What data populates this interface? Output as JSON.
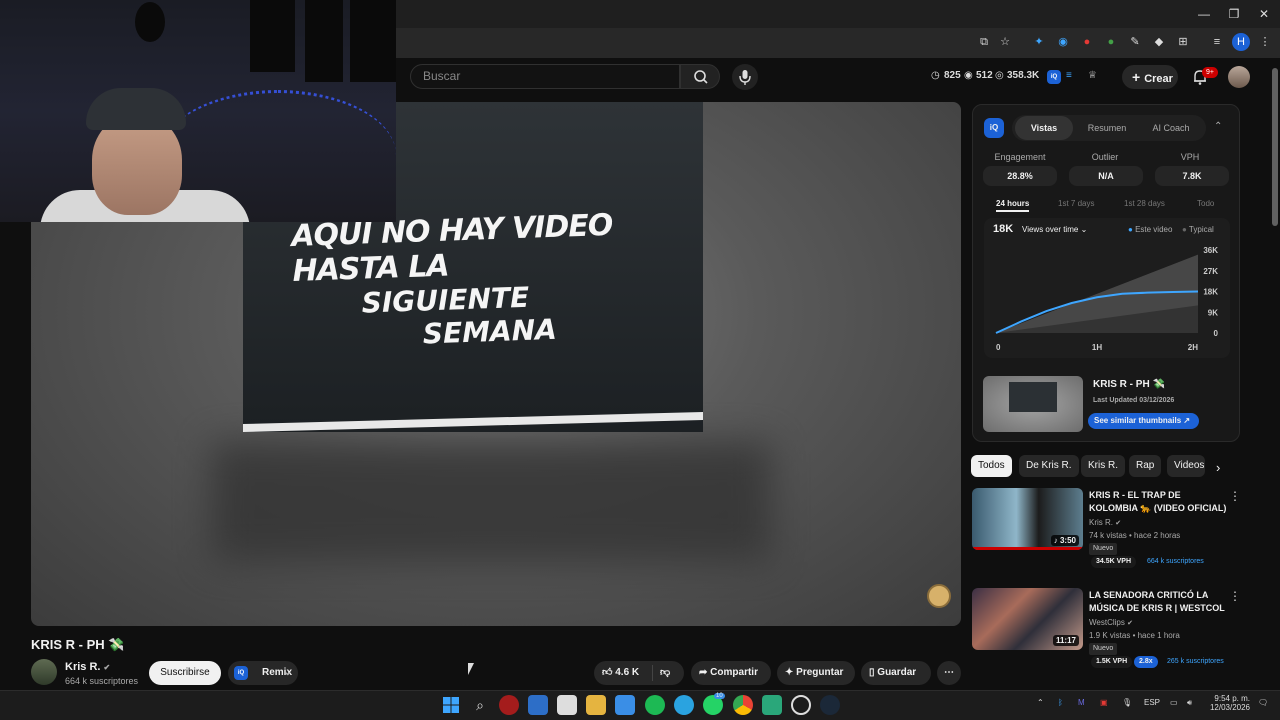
{
  "browser": {
    "controls": {
      "minimize": "—",
      "restore": "❐",
      "close": "✕"
    }
  },
  "youtube": {
    "search_placeholder": "Buscar",
    "stats": {
      "a": "825",
      "b": "512",
      "c": "358.3K"
    },
    "create_label": "Crear",
    "notif_badge": "9+"
  },
  "video": {
    "overlay_text": {
      "line1": "AQUI NO HAY VIDEO HASTA LA",
      "line2": "SIGUIENTE",
      "line3": "SEMANA"
    },
    "title": "KRIS R - PH 💸",
    "channel": {
      "name": "Kris R.",
      "subscribers": "664 k suscriptores"
    },
    "subscribe_label": "Suscribirse",
    "remix_label": "Remix",
    "likes": "4.6 K",
    "share_label": "Compartir",
    "ask_label": "Preguntar",
    "save_label": "Guardar"
  },
  "analytics": {
    "logo": "iQ",
    "tabs": [
      "Vistas",
      "Resumen",
      "AI Coach"
    ],
    "metrics": [
      {
        "label": "Engagement",
        "value": "28.8%"
      },
      {
        "label": "Outlier",
        "value": "N/A"
      },
      {
        "label": "VPH",
        "value": "7.8K"
      }
    ],
    "timeframes": [
      "24 hours",
      "1st 7 days",
      "1st 28 days",
      "Todo"
    ],
    "chart_current": "18K",
    "chart_dropdown": "Views over time",
    "legend": {
      "this": "Este video",
      "typical": "Typical"
    }
  },
  "chart_data": {
    "type": "line",
    "title": "",
    "xlabel": "",
    "ylabel": "",
    "x_ticks": [
      "0",
      "1H",
      "2H"
    ],
    "y_ticks": [
      "36K",
      "27K",
      "18K",
      "9K",
      "0"
    ],
    "ylim": [
      0,
      36000
    ],
    "series": [
      {
        "name": "Este video",
        "x": [
          0,
          0.25,
          0.5,
          0.75,
          1.0,
          1.25,
          1.5,
          1.75,
          2.0
        ],
        "values": [
          0,
          5000,
          9500,
          13000,
          15500,
          17000,
          17500,
          17800,
          18000
        ]
      },
      {
        "name": "Typical",
        "x": [
          0,
          2.0
        ],
        "values": [
          0,
          34000
        ]
      }
    ],
    "colors": {
      "this": "#3ea6ff",
      "typical": "#555555"
    }
  },
  "thumb_card": {
    "title": "KRIS R - PH 💸",
    "updated": "Last Updated 03/12/2026",
    "button": "See similar thumbnails ↗"
  },
  "chips": [
    "Todos",
    "De Kris R.",
    "Kris R.",
    "Rap",
    "Videos"
  ],
  "recommendations": [
    {
      "title": "KRIS R - EL TRAP DE KOLOMBIA 🐆 (VIDEO OFICIAL)",
      "channel": "Kris R.",
      "meta": "74 k vistas • hace 2 horas",
      "badge": "Nuevo",
      "duration": "3:50",
      "vph": "34.5K VPH",
      "subs": "664 k suscriptores"
    },
    {
      "title": "LA SENADORA CRITICÓ LA MÚSICA DE KRIS R | WESTCOL",
      "channel": "WestClips",
      "meta": "1.9 K vistas • hace 1 hora",
      "badge": "Nuevo",
      "duration": "11:17",
      "vph": "1.5K VPH",
      "mult": "2.8x",
      "subs": "265 k suscriptores"
    }
  ],
  "taskbar": {
    "lang": "ESP",
    "time": "9:54 p. m.",
    "date": "12/03/2026",
    "whatsapp_badge": "10"
  }
}
